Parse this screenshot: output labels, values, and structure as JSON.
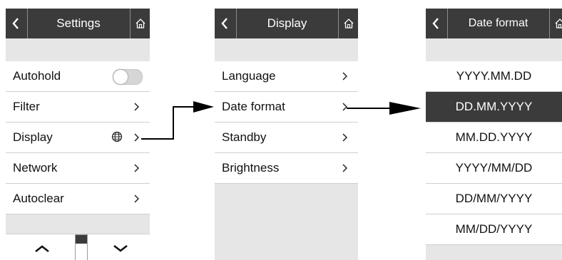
{
  "settings_panel": {
    "title": "Settings",
    "items": [
      {
        "label": "Autohold",
        "control": "toggle",
        "toggle_on": false
      },
      {
        "label": "Filter",
        "control": "chevron"
      },
      {
        "label": "Display",
        "control": "chevron",
        "extra_icon": "globe-icon"
      },
      {
        "label": "Network",
        "control": "chevron"
      },
      {
        "label": "Autoclear",
        "control": "chevron"
      }
    ]
  },
  "display_panel": {
    "title": "Display",
    "items": [
      {
        "label": "Language"
      },
      {
        "label": "Date format"
      },
      {
        "label": "Standby"
      },
      {
        "label": "Brightness"
      }
    ]
  },
  "date_format_panel": {
    "title": "Date format",
    "selected": "DD.MM.YYYY",
    "options": [
      "YYYY.MM.DD",
      "DD.MM.YYYY",
      "MM.DD.YYYY",
      "YYYY/MM/DD",
      "DD/MM/YYYY",
      "MM/DD/YYYY"
    ]
  },
  "icons": {
    "back": "chevron-left-icon",
    "home": "home-icon",
    "chevron": "chevron-right-icon",
    "globe": "globe-icon",
    "scroll_up": "chevron-up-icon",
    "scroll_down": "chevron-down-icon"
  },
  "colors": {
    "header_bg": "#3b3b3b",
    "panel_bg": "#e6e6e6",
    "row_bg": "#ffffff",
    "selected_bg": "#3b3b3b"
  }
}
